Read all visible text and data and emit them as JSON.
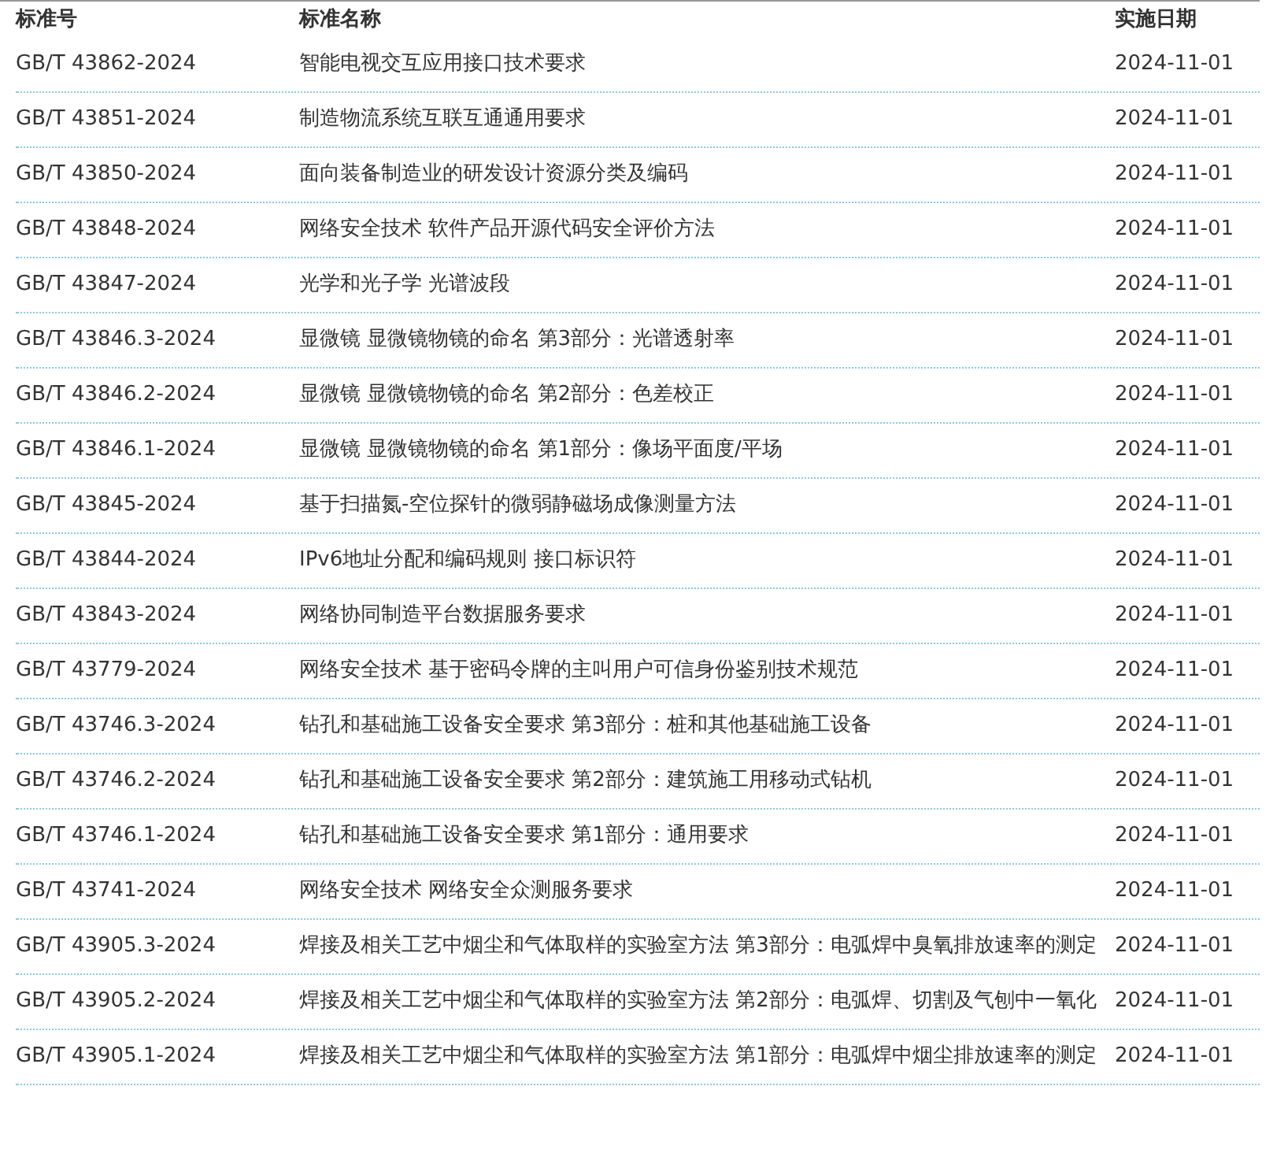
{
  "table": {
    "columns": [
      "标准号",
      "标准名称",
      "实施日期"
    ],
    "rows": [
      [
        "GB/T 43862-2024",
        "智能电视交互应用接口技术要求",
        "2024-11-01"
      ],
      [
        "GB/T 43851-2024",
        "制造物流系统互联互通通用要求",
        "2024-11-01"
      ],
      [
        "GB/T 43850-2024",
        "面向装备制造业的研发设计资源分类及编码",
        "2024-11-01"
      ],
      [
        "GB/T 43848-2024",
        "网络安全技术 软件产品开源代码安全评价方法",
        "2024-11-01"
      ],
      [
        "GB/T 43847-2024",
        "光学和光子学 光谱波段",
        "2024-11-01"
      ],
      [
        "GB/T 43846.3-2024",
        "显微镜 显微镜物镜的命名 第3部分：光谱透射率",
        "2024-11-01"
      ],
      [
        "GB/T 43846.2-2024",
        "显微镜 显微镜物镜的命名 第2部分：色差校正",
        "2024-11-01"
      ],
      [
        "GB/T 43846.1-2024",
        "显微镜 显微镜物镜的命名 第1部分：像场平面度/平场",
        "2024-11-01"
      ],
      [
        "GB/T 43845-2024",
        "基于扫描氮-空位探针的微弱静磁场成像测量方法",
        "2024-11-01"
      ],
      [
        "GB/T 43844-2024",
        "IPv6地址分配和编码规则 接口标识符",
        "2024-11-01"
      ],
      [
        "GB/T 43843-2024",
        "网络协同制造平台数据服务要求",
        "2024-11-01"
      ],
      [
        "GB/T 43779-2024",
        "网络安全技术 基于密码令牌的主叫用户可信身份鉴别技术规范",
        "2024-11-01"
      ],
      [
        "GB/T 43746.3-2024",
        "钻孔和基础施工设备安全要求 第3部分：桩和其他基础施工设备",
        "2024-11-01"
      ],
      [
        "GB/T 43746.2-2024",
        "钻孔和基础施工设备安全要求 第2部分：建筑施工用移动式钻机",
        "2024-11-01"
      ],
      [
        "GB/T 43746.1-2024",
        "钻孔和基础施工设备安全要求 第1部分：通用要求",
        "2024-11-01"
      ],
      [
        "GB/T 43741-2024",
        "网络安全技术 网络安全众测服务要求",
        "2024-11-01"
      ],
      [
        "GB/T 43905.3-2024",
        "焊接及相关工艺中烟尘和气体取样的实验室方法 第3部分：电弧焊中臭氧排放速率的测定",
        "2024-11-01"
      ],
      [
        "GB/T 43905.2-2024",
        "焊接及相关工艺中烟尘和气体取样的实验室方法 第2部分：电弧焊、切割及气刨中一氧化",
        "2024-11-01"
      ],
      [
        "GB/T 43905.1-2024",
        "焊接及相关工艺中烟尘和气体取样的实验室方法 第1部分：电弧焊中烟尘排放速率的测定",
        "2024-11-01"
      ]
    ]
  }
}
